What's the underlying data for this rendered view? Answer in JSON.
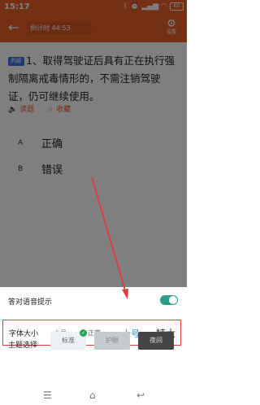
{
  "status_bar": {
    "time": "15:17",
    "icons": [
      "bluetooth-icon",
      "alarm-icon",
      "signal-icon",
      "wifi-icon"
    ],
    "battery": "60"
  },
  "header": {
    "countdown": "倒计时 44:53",
    "settings_label": "设置"
  },
  "question": {
    "type_badge": "判断",
    "text": "1、取得驾驶证后具有正在执行强制隔离戒毒情形的，不需注销驾驶证，仍可继续使用。",
    "read_label": "读题",
    "favorite_label": "收藏"
  },
  "options": [
    {
      "letter": "A",
      "text": "正确"
    },
    {
      "letter": "B",
      "text": "错误"
    }
  ],
  "settings_panel": {
    "voice_hint_label": "答对语音提示",
    "voice_hint_on": true,
    "font_size_label": "字体大小",
    "font_sizes": [
      "小号",
      "正常",
      "大号",
      "特大"
    ],
    "font_size_selected": "大号",
    "theme_label": "主题选择",
    "themes": [
      "标准",
      "护眼",
      "夜间"
    ],
    "theme_selected": "标准"
  },
  "colors": {
    "header": "#e8602b",
    "selected": "#2f8ee8",
    "toggle": "#2d9d8a",
    "annotation": "#e33a3a"
  }
}
